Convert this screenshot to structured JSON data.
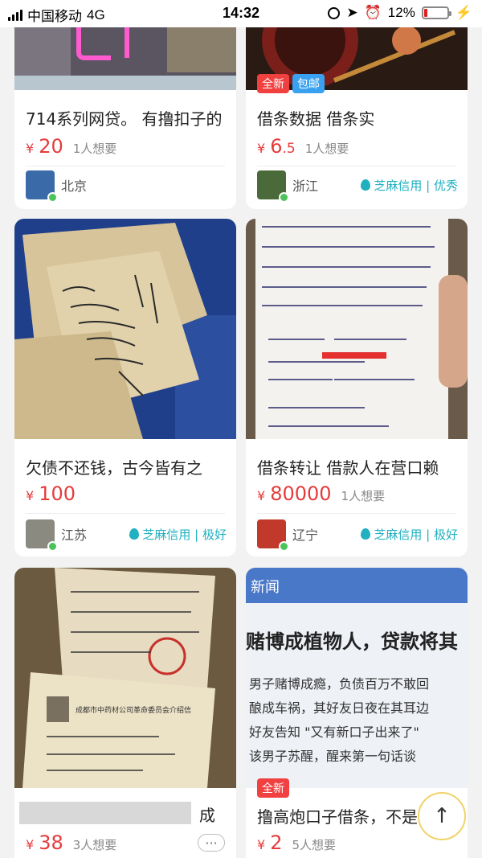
{
  "status": {
    "carrier": "中国移动",
    "network": "4G",
    "time": "14:32",
    "battery": "12%"
  },
  "cards": [
    {
      "title": "714系列网贷。 有撸扣子的",
      "price": "20",
      "wants": "1人想要",
      "location": "北京",
      "credit": ""
    },
    {
      "title": "借条数据 借条实",
      "price": "6",
      "price_dec": ".5",
      "wants": "1人想要",
      "location": "浙江",
      "credit": "芝麻信用 | 优秀",
      "tags": [
        "全新",
        "包邮"
      ]
    },
    {
      "title": "欠债不还钱，古今皆有之",
      "price": "100",
      "location": "江苏",
      "credit": "芝麻信用 | 极好"
    },
    {
      "title": "借条转让 借款人在营口赖",
      "price": "80000",
      "wants": "1人想要",
      "location": "辽宁",
      "credit": "芝麻信用 | 极好"
    },
    {
      "title_tail": "成",
      "price": "38",
      "wants": "3人想要"
    },
    {
      "title": "撸高炮口子借条，不是",
      "price": "2",
      "wants": "5人想要",
      "tags": [
        "全新"
      ]
    }
  ],
  "image_text": {
    "news_header": "新闻",
    "news_headline": "赌博成植物人，贷款将其",
    "news_lines": [
      "男子赌博成瘾，负债百万不敢回",
      "酿成车祸，其好友日夜在其耳边",
      "好友告知 \"又有新口子出来了\"",
      "该男子苏醒，醒来第一句话谈"
    ],
    "doc_caption": "成都市中药材公司革命委员会介绍信"
  },
  "currency": "¥",
  "more_label": "···",
  "scroll_top_label": "↑",
  "colors": {
    "price": "#e63b3b",
    "credit": "#20b0c0",
    "tag_red": "#f04040",
    "tag_blue": "#3aa0f0"
  }
}
